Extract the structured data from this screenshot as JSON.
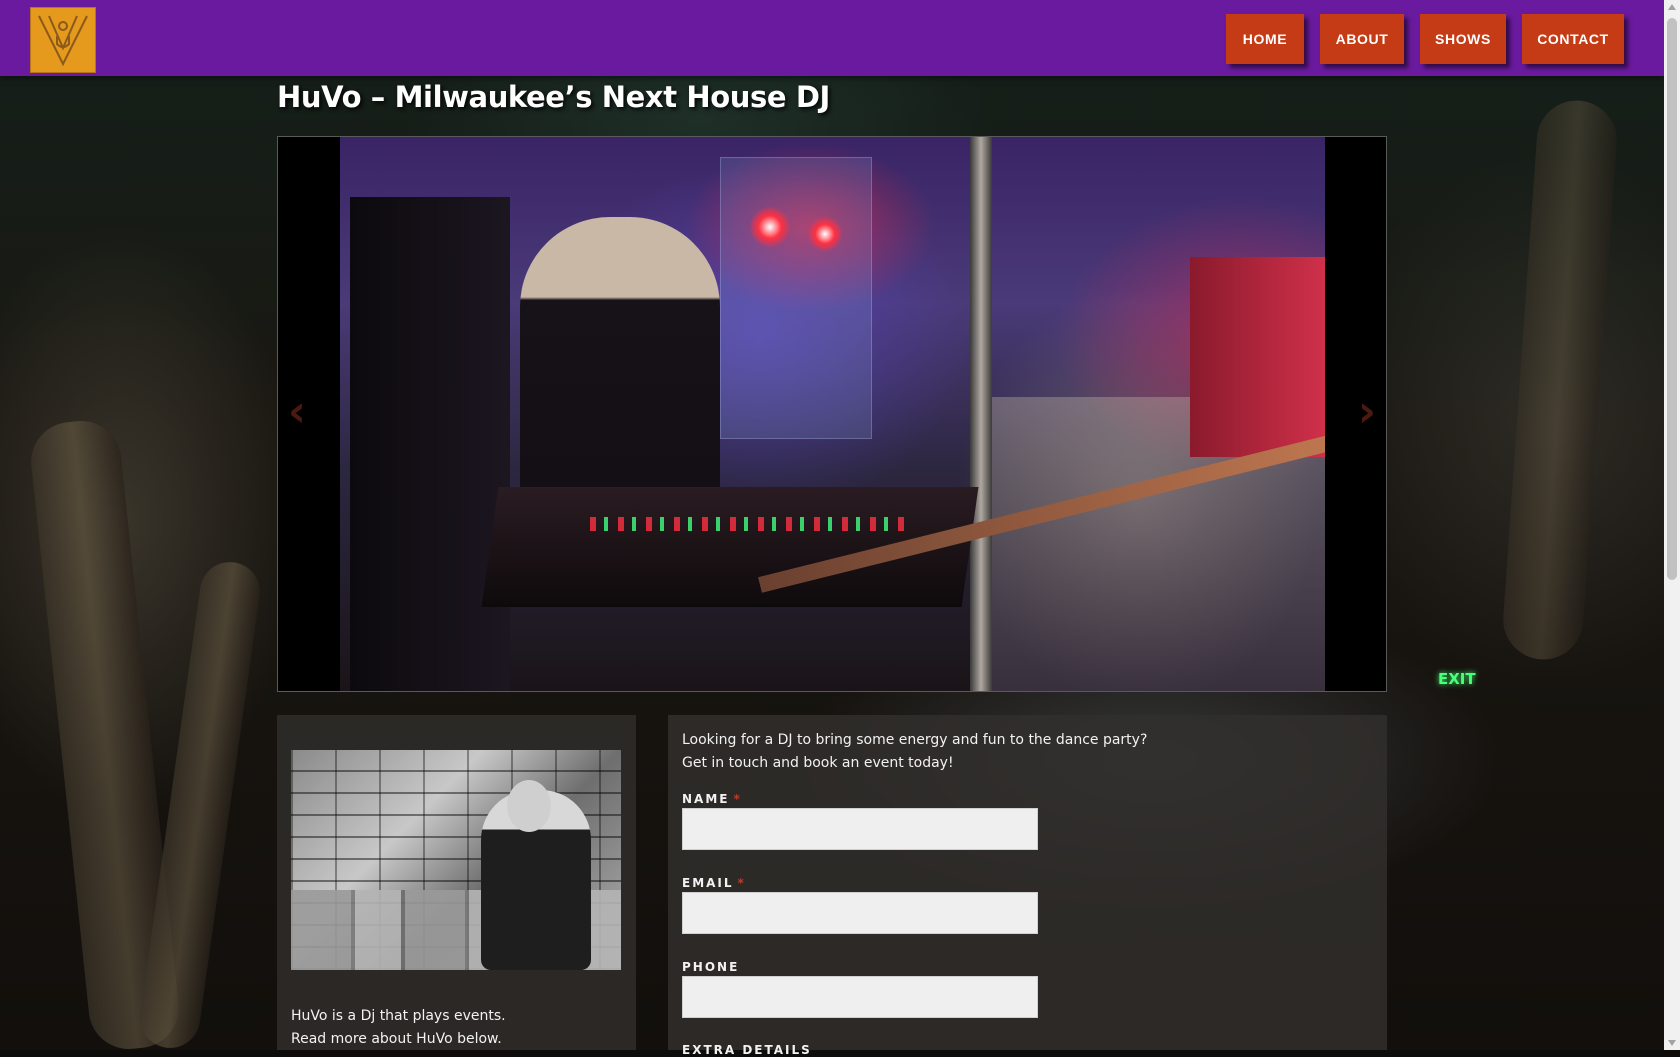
{
  "header": {
    "logo_alt": "HuVo logo",
    "nav": [
      {
        "label": "HOME"
      },
      {
        "label": "ABOUT"
      },
      {
        "label": "SHOWS"
      },
      {
        "label": "CONTACT"
      }
    ],
    "colors": {
      "bar": "#6a1a9e",
      "button": "#c43b15",
      "logo": "#e59a1e"
    }
  },
  "page": {
    "title": "HuVo – Milwaukee’s Next House DJ"
  },
  "slider": {
    "prev_icon": "chevron-left-icon",
    "next_icon": "chevron-right-icon",
    "prev_glyph": "‹",
    "next_glyph": "›"
  },
  "about": {
    "lines": [
      "HuVo is a Dj that plays events.",
      "Read more about HuVo below."
    ]
  },
  "contact": {
    "intro_lines": [
      "Looking for a DJ to bring some energy and fun to the dance party?",
      "Get in touch and book an event today!"
    ],
    "fields": [
      {
        "label": "NAME",
        "required": "*",
        "value": "",
        "placeholder": ""
      },
      {
        "label": "EMAIL",
        "required": "*",
        "value": "",
        "placeholder": ""
      },
      {
        "label": "PHONE",
        "required": "",
        "value": "",
        "placeholder": ""
      },
      {
        "label": "EXTRA DETAILS",
        "required": "",
        "value": "",
        "placeholder": ""
      }
    ]
  },
  "background": {
    "exit_sign": "EXIT"
  }
}
